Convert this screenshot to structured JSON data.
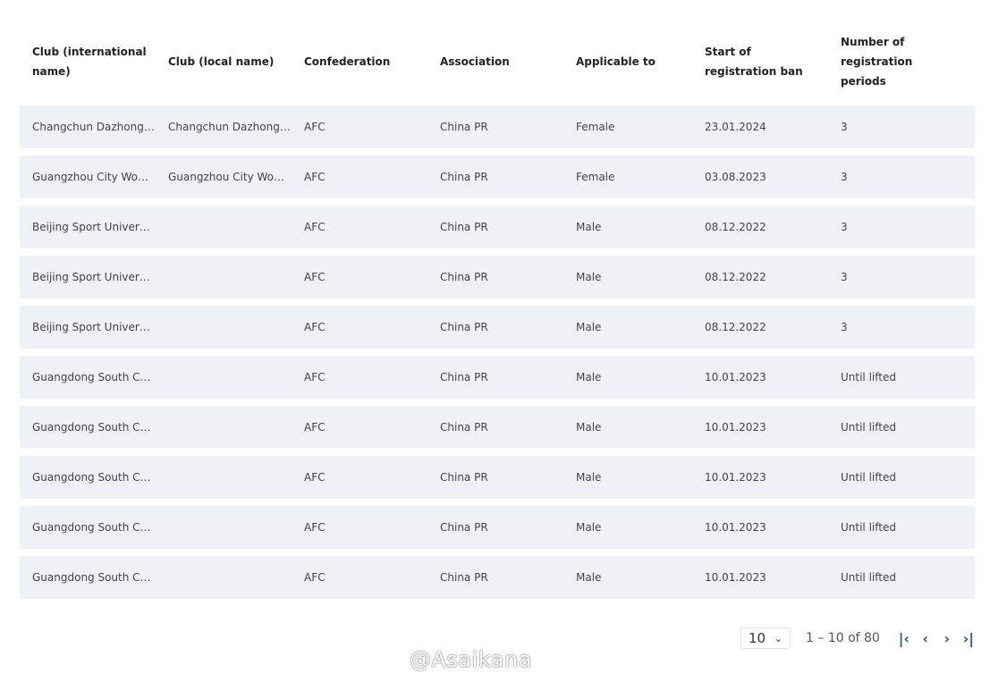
{
  "columns": [
    "Club (international name)",
    "Club (local name)",
    "Confederation",
    "Association",
    "Applicable to",
    "Start of registration ban",
    "Number of registration periods"
  ],
  "rows": [
    [
      "Changchun Dazhong Zhuoyue",
      "Changchun Dazhong Zhuoyue",
      "AFC",
      "China PR",
      "Female",
      "23.01.2024",
      "3"
    ],
    [
      "Guangzhou City Women",
      "Guangzhou City Women",
      "AFC",
      "China PR",
      "Female",
      "03.08.2023",
      "3"
    ],
    [
      "Beijing Sport University",
      "",
      "AFC",
      "China PR",
      "Male",
      "08.12.2022",
      "3"
    ],
    [
      "Beijing Sport University",
      "",
      "AFC",
      "China PR",
      "Male",
      "08.12.2022",
      "3"
    ],
    [
      "Beijing Sport University",
      "",
      "AFC",
      "China PR",
      "Male",
      "08.12.2022",
      "3"
    ],
    [
      "Guangdong South China",
      "",
      "AFC",
      "China PR",
      "Male",
      "10.01.2023",
      "Until lifted"
    ],
    [
      "Guangdong South China",
      "",
      "AFC",
      "China PR",
      "Male",
      "10.01.2023",
      "Until lifted"
    ],
    [
      "Guangdong South China",
      "",
      "AFC",
      "China PR",
      "Male",
      "10.01.2023",
      "Until lifted"
    ],
    [
      "Guangdong South China",
      "",
      "AFC",
      "China PR",
      "Male",
      "10.01.2023",
      "Until lifted"
    ],
    [
      "Guangdong South China",
      "",
      "AFC",
      "China PR",
      "Male",
      "10.01.2023",
      "Until lifted"
    ]
  ],
  "pagination": {
    "page_size": "10",
    "range": "1 – 10 of 80",
    "icons": [
      "first-page-icon",
      "prev-page-icon",
      "next-page-icon",
      "last-page-icon"
    ]
  },
  "watermark": "@Asaikana",
  "colors": {
    "row_bg": "#eef1f6",
    "accent": "#2b5a87"
  }
}
